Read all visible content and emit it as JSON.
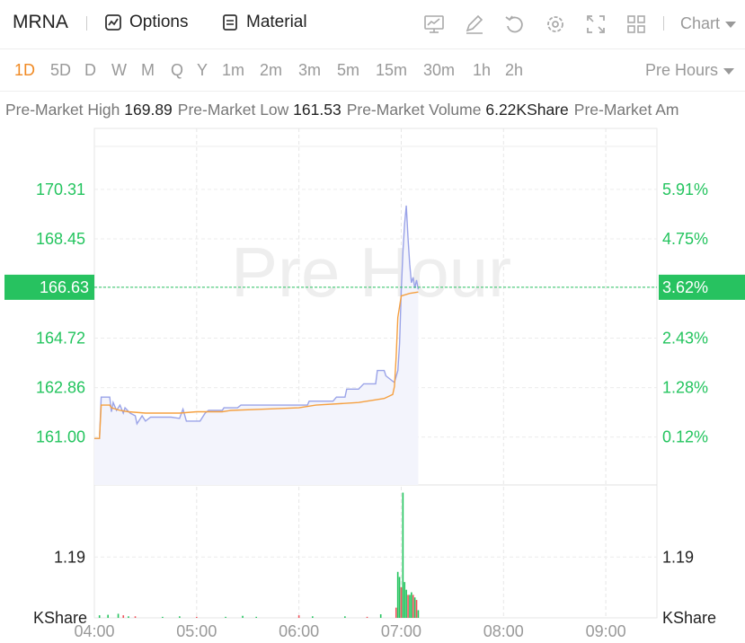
{
  "header": {
    "ticker": "MRNA",
    "options_label": "Options",
    "material_label": "Material",
    "tools": [
      "indicator-icon",
      "draw-icon",
      "undo-icon",
      "settings-icon",
      "fullscreen-icon",
      "layout-icon"
    ],
    "chart_label": "Chart"
  },
  "periods": [
    "1D",
    "5D",
    "D",
    "W",
    "M",
    "Q",
    "Y",
    "1m",
    "2m",
    "3m",
    "5m",
    "15m",
    "30m",
    "1h",
    "2h"
  ],
  "active_period": "1D",
  "session_label": "Pre Hours",
  "stats": [
    {
      "label": "Pre-Market High",
      "value": "169.89"
    },
    {
      "label": "Pre-Market Low",
      "value": "161.53"
    },
    {
      "label": "Pre-Market Volume",
      "value": "6.22KShare"
    },
    {
      "label": "Pre-Market Am",
      "value": ""
    }
  ],
  "watermark": "Pre Hour",
  "colors": {
    "up": "#23c45e",
    "down": "#f0505a",
    "price_line": "#9aa3e8",
    "avg_line": "#f5a040",
    "accent": "#f08a24",
    "current": "#27c260"
  },
  "chart_data": {
    "type": "line",
    "price_axis_labels": [
      "170.31",
      "168.45",
      "166.63",
      "164.72",
      "162.86",
      "161.00"
    ],
    "price_axis_values": [
      170.31,
      168.45,
      166.63,
      164.72,
      162.86,
      161.0
    ],
    "percent_axis_labels": [
      "5.91%",
      "4.75%",
      "3.62%",
      "2.43%",
      "1.28%",
      "0.12%"
    ],
    "current_price": "166.63",
    "current_percent": "3.62%",
    "x_tick_labels": [
      "04:00",
      "05:00",
      "06:00",
      "07:00",
      "08:00",
      "09:00"
    ],
    "x_tick_minutes": [
      0,
      60,
      120,
      180,
      240,
      300
    ],
    "x_range_minutes": [
      0,
      330
    ],
    "y_range": [
      159.2,
      172.6
    ],
    "volume_axis_label": "1.19",
    "volume_unit": "KShare",
    "volume_range": [
      0,
      2.6
    ],
    "volume_reference": 1.19,
    "series": [
      {
        "name": "",
        "color": "#9aa3e8",
        "points": [
          [
            0,
            160.95
          ],
          [
            3,
            160.95
          ],
          [
            4,
            162.5
          ],
          [
            9,
            162.5
          ],
          [
            10,
            161.95
          ],
          [
            11,
            162.3
          ],
          [
            13,
            162.0
          ],
          [
            15,
            162.2
          ],
          [
            17,
            161.9
          ],
          [
            18,
            162.1
          ],
          [
            21,
            161.9
          ],
          [
            24,
            161.8
          ],
          [
            25,
            161.5
          ],
          [
            28,
            161.8
          ],
          [
            30,
            161.6
          ],
          [
            33,
            161.75
          ],
          [
            45,
            161.75
          ],
          [
            50,
            161.7
          ],
          [
            52,
            162.05
          ],
          [
            54,
            161.6
          ],
          [
            62,
            161.6
          ],
          [
            65,
            161.9
          ],
          [
            67,
            162.0
          ],
          [
            75,
            162.0
          ],
          [
            76,
            162.1
          ],
          [
            84,
            162.1
          ],
          [
            86,
            162.2
          ],
          [
            125,
            162.2
          ],
          [
            126,
            162.35
          ],
          [
            140,
            162.35
          ],
          [
            142,
            162.5
          ],
          [
            147,
            162.5
          ],
          [
            148,
            162.8
          ],
          [
            155,
            162.8
          ],
          [
            158,
            163.0
          ],
          [
            165,
            163.0
          ],
          [
            166,
            163.5
          ],
          [
            170,
            163.5
          ],
          [
            171,
            163.3
          ],
          [
            173,
            163.2
          ],
          [
            175,
            163.1
          ],
          [
            176,
            163.05
          ],
          [
            178,
            163.5
          ],
          [
            179,
            164.5
          ],
          [
            180,
            166.5
          ],
          [
            181,
            168.0
          ],
          [
            182,
            169.0
          ],
          [
            183,
            169.7
          ],
          [
            184,
            168.5
          ],
          [
            185,
            167.5
          ],
          [
            186,
            166.8
          ],
          [
            187,
            167.0
          ],
          [
            188,
            166.6
          ],
          [
            189,
            166.9
          ],
          [
            190,
            166.55
          ]
        ]
      },
      {
        "name": "",
        "color": "#f5a040",
        "points": [
          [
            0,
            160.95
          ],
          [
            3,
            160.95
          ],
          [
            4,
            162.2
          ],
          [
            9,
            162.2
          ],
          [
            10,
            162.1
          ],
          [
            15,
            162.0
          ],
          [
            20,
            161.95
          ],
          [
            30,
            161.9
          ],
          [
            50,
            161.9
          ],
          [
            60,
            161.95
          ],
          [
            75,
            161.95
          ],
          [
            80,
            162.0
          ],
          [
            100,
            162.05
          ],
          [
            120,
            162.1
          ],
          [
            130,
            162.2
          ],
          [
            155,
            162.3
          ],
          [
            160,
            162.35
          ],
          [
            170,
            162.45
          ],
          [
            175,
            162.6
          ],
          [
            176,
            162.9
          ],
          [
            177,
            164.0
          ],
          [
            178,
            165.5
          ],
          [
            180,
            166.3
          ],
          [
            185,
            166.4
          ],
          [
            190,
            166.45
          ]
        ]
      }
    ],
    "volume_bars": [
      {
        "t": 3,
        "v": 0.05,
        "up": true
      },
      {
        "t": 8,
        "v": 0.06,
        "up": true
      },
      {
        "t": 14,
        "v": 0.08,
        "up": true
      },
      {
        "t": 17,
        "v": 0.05,
        "up": false
      },
      {
        "t": 20,
        "v": 0.03,
        "up": true
      },
      {
        "t": 24,
        "v": 0.03,
        "up": false
      },
      {
        "t": 40,
        "v": 0.02,
        "up": true
      },
      {
        "t": 50,
        "v": 0.03,
        "up": true
      },
      {
        "t": 60,
        "v": 0.02,
        "up": false
      },
      {
        "t": 77,
        "v": 0.02,
        "up": true
      },
      {
        "t": 87,
        "v": 0.04,
        "up": true
      },
      {
        "t": 95,
        "v": 0.02,
        "up": true
      },
      {
        "t": 120,
        "v": 0.05,
        "up": false
      },
      {
        "t": 128,
        "v": 0.03,
        "up": true
      },
      {
        "t": 147,
        "v": 0.03,
        "up": true
      },
      {
        "t": 160,
        "v": 0.02,
        "up": false
      },
      {
        "t": 168,
        "v": 0.07,
        "up": true
      },
      {
        "t": 177,
        "v": 0.2,
        "up": false
      },
      {
        "t": 178,
        "v": 0.9,
        "up": true
      },
      {
        "t": 179,
        "v": 0.8,
        "up": true
      },
      {
        "t": 180,
        "v": 0.6,
        "up": false
      },
      {
        "t": 181,
        "v": 2.45,
        "up": true
      },
      {
        "t": 182,
        "v": 0.7,
        "up": true
      },
      {
        "t": 183,
        "v": 0.55,
        "up": true
      },
      {
        "t": 184,
        "v": 0.45,
        "up": false
      },
      {
        "t": 185,
        "v": 0.45,
        "up": true
      },
      {
        "t": 186,
        "v": 0.5,
        "up": true
      },
      {
        "t": 187,
        "v": 0.45,
        "up": false
      },
      {
        "t": 188,
        "v": 0.4,
        "up": true
      },
      {
        "t": 189,
        "v": 0.35,
        "up": false
      },
      {
        "t": 190,
        "v": 0.15,
        "up": true
      }
    ]
  }
}
